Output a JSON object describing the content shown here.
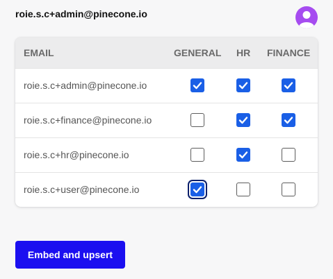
{
  "header": {
    "user_email": "roie.s.c+admin@pinecone.io",
    "avatar_icon": "user-avatar-icon",
    "avatar_color": "#a64cf0"
  },
  "table": {
    "columns": {
      "email": "EMAIL",
      "general": "GENERAL",
      "hr": "HR",
      "finance": "FINANCE"
    },
    "rows": [
      {
        "email": "roie.s.c+admin@pinecone.io",
        "general": true,
        "hr": true,
        "finance": true
      },
      {
        "email": "roie.s.c+finance@pinecone.io",
        "general": false,
        "hr": true,
        "finance": true
      },
      {
        "email": "roie.s.c+hr@pinecone.io",
        "general": false,
        "hr": true,
        "finance": false
      },
      {
        "email": "roie.s.c+user@pinecone.io",
        "general": true,
        "hr": false,
        "finance": false
      }
    ],
    "focused_cell": {
      "row": 3,
      "column": "general"
    }
  },
  "actions": {
    "embed_label": "Embed and upsert"
  },
  "colors": {
    "checkbox_checked": "#1a5fe6",
    "button_primary": "#1b0ff0",
    "header_bg": "#ececed"
  }
}
